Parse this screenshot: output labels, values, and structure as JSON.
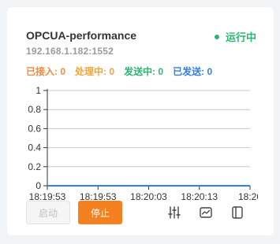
{
  "card": {
    "title": "OPCUA-performance",
    "status": "运行中",
    "address": "192.168.1.182:1552"
  },
  "counters": [
    {
      "label": "已接入:",
      "value": "0",
      "color": "#f5883b"
    },
    {
      "label": "处理中:",
      "value": "0",
      "color": "#f2a33a"
    },
    {
      "label": "发送中:",
      "value": "0",
      "color": "#2bb573"
    },
    {
      "label": "已发送:",
      "value": "0",
      "color": "#2f7fe5"
    }
  ],
  "chart_data": {
    "type": "line",
    "title": "",
    "xlabel": "",
    "ylabel": "",
    "x": [
      "18:19:53",
      "18:19:53",
      "18:20:03",
      "18:20:13",
      "18:20"
    ],
    "y_ticks": [
      "0",
      "0.2",
      "0.4",
      "0.6",
      "0.8",
      "1"
    ],
    "ylim": [
      0,
      1
    ],
    "grid": true,
    "series": [
      {
        "values": [
          0,
          0,
          0,
          0,
          0
        ],
        "color": "#2f7fe5"
      }
    ]
  },
  "buttons": {
    "start": "启动",
    "stop": "停止"
  },
  "icons": [
    "sliders-icon",
    "chart-monitor-icon",
    "panel-icon"
  ],
  "colors": {
    "running": "#2bb573",
    "accent": "#f5801f"
  }
}
